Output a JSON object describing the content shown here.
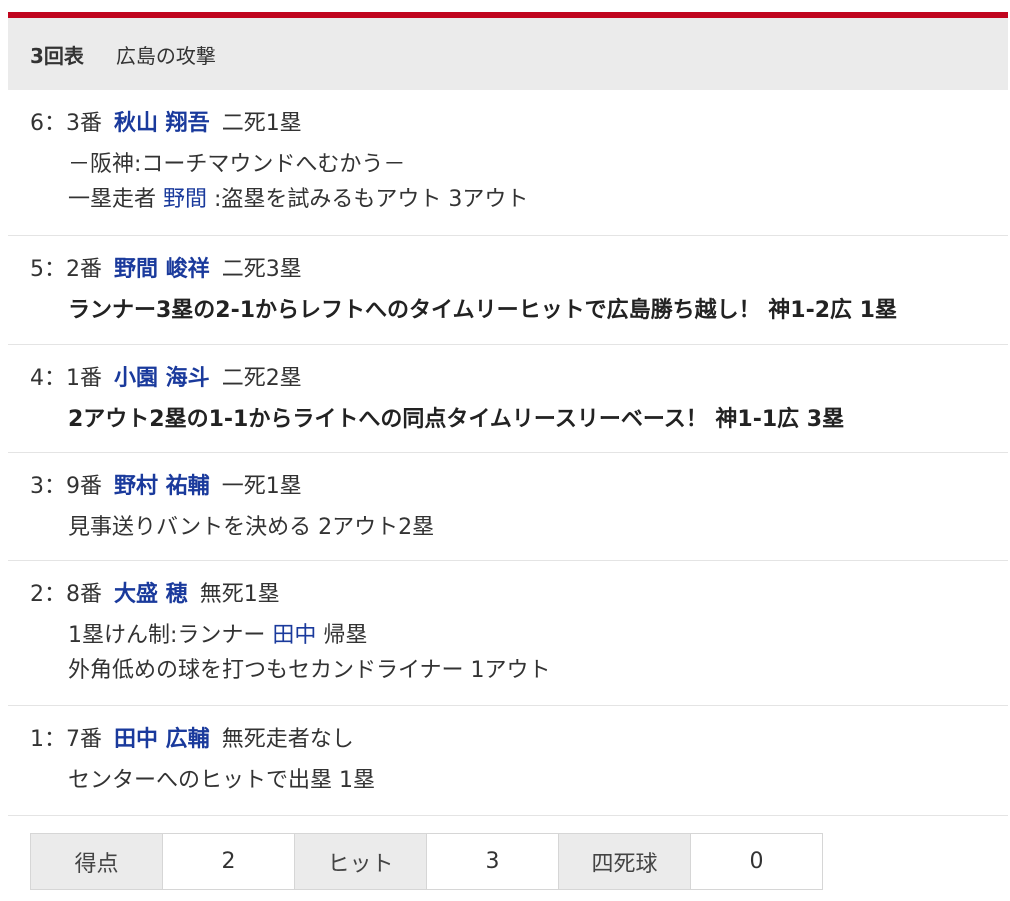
{
  "header": {
    "inning": "3回表",
    "team_attack": "広島の攻撃"
  },
  "plays": [
    {
      "seq": "6",
      "order": "3番",
      "batter": "秋山 翔吾",
      "situation": "二死1塁",
      "lines": [
        {
          "parts": [
            {
              "text": "－阪神:コーチマウンドへむかう－",
              "type": "plain"
            }
          ]
        },
        {
          "parts": [
            {
              "text": "一塁走者 ",
              "type": "plain"
            },
            {
              "text": "野間",
              "type": "runner"
            },
            {
              "text": " :盗塁を試みるもアウト 3アウト",
              "type": "plain"
            }
          ]
        }
      ]
    },
    {
      "seq": "5",
      "order": "2番",
      "batter": "野間 峻祥",
      "situation": "二死3塁",
      "lines": [
        {
          "bold": true,
          "parts": [
            {
              "text": "ランナー3塁の2-1からレフトへのタイムリーヒットで広島勝ち越し！ 神1-2広 1塁",
              "type": "plain"
            }
          ]
        }
      ]
    },
    {
      "seq": "4",
      "order": "1番",
      "batter": "小園 海斗",
      "situation": "二死2塁",
      "lines": [
        {
          "bold": true,
          "parts": [
            {
              "text": "2アウト2塁の1-1からライトへの同点タイムリースリーベース！ 神1-1広 3塁",
              "type": "plain"
            }
          ]
        }
      ]
    },
    {
      "seq": "3",
      "order": "9番",
      "batter": "野村 祐輔",
      "situation": "一死1塁",
      "lines": [
        {
          "parts": [
            {
              "text": "見事送りバントを決める 2アウト2塁",
              "type": "plain"
            }
          ]
        }
      ]
    },
    {
      "seq": "2",
      "order": "8番",
      "batter": "大盛 穂",
      "situation": "無死1塁",
      "lines": [
        {
          "parts": [
            {
              "text": "1塁けん制:ランナー ",
              "type": "plain"
            },
            {
              "text": "田中",
              "type": "runner"
            },
            {
              "text": " 帰塁",
              "type": "plain"
            }
          ]
        },
        {
          "parts": [
            {
              "text": "外角低めの球を打つもセカンドライナー 1アウト",
              "type": "plain"
            }
          ]
        }
      ]
    },
    {
      "seq": "1",
      "order": "7番",
      "batter": "田中 広輔",
      "situation": "無死走者なし",
      "lines": [
        {
          "parts": [
            {
              "text": "センターへのヒットで出塁 1塁",
              "type": "plain"
            }
          ]
        }
      ]
    }
  ],
  "summary": [
    {
      "label": "得点",
      "value": "2"
    },
    {
      "label": "ヒット",
      "value": "3"
    },
    {
      "label": "四死球",
      "value": "0"
    }
  ],
  "colors": {
    "accent_red": "#c0051e",
    "player_blue": "#1a3a9c",
    "header_gray": "#ebebeb"
  }
}
